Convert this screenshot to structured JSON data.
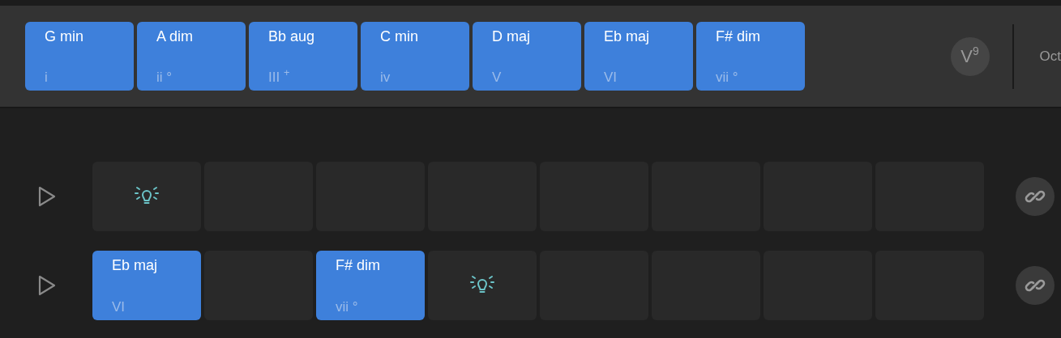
{
  "scale_chords": [
    {
      "name": "G min",
      "numeral": "i"
    },
    {
      "name": "A dim",
      "numeral": "ii °"
    },
    {
      "name": "Bb aug",
      "numeral": "III $^{+}$"
    },
    {
      "name": "C min",
      "numeral": "iv"
    },
    {
      "name": "D maj",
      "numeral": "V"
    },
    {
      "name": "Eb maj",
      "numeral": "VI"
    },
    {
      "name": "F# dim",
      "numeral": "vii °"
    }
  ],
  "extension_button": "V$^{9}$",
  "octave_label": "Oct",
  "tracks": [
    {
      "cells": [
        {
          "kind": "hint"
        },
        {
          "kind": "empty"
        },
        {
          "kind": "empty"
        },
        {
          "kind": "empty"
        },
        {
          "kind": "empty"
        },
        {
          "kind": "empty"
        },
        {
          "kind": "empty"
        },
        {
          "kind": "empty"
        }
      ]
    },
    {
      "cells": [
        {
          "kind": "chord",
          "name": "Eb maj",
          "numeral": "VI"
        },
        {
          "kind": "empty"
        },
        {
          "kind": "chord",
          "name": "F# dim",
          "numeral": "vii °"
        },
        {
          "kind": "hint"
        },
        {
          "kind": "empty"
        },
        {
          "kind": "empty"
        },
        {
          "kind": "empty"
        },
        {
          "kind": "empty"
        }
      ]
    }
  ]
}
